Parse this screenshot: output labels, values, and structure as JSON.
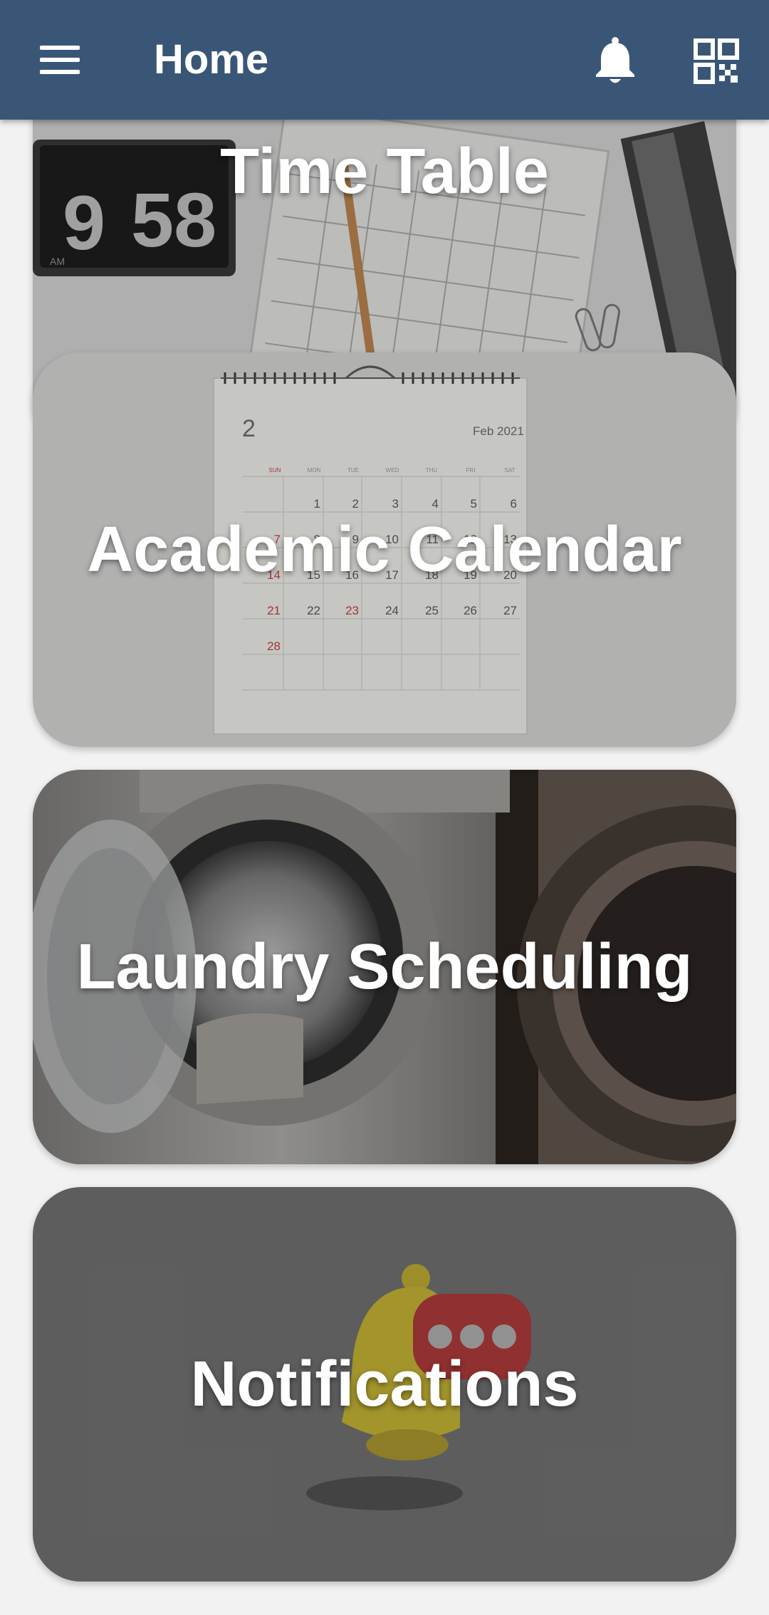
{
  "appbar": {
    "title": "Home",
    "menu_icon": "hamburger-menu-icon",
    "notification_icon": "bell-icon",
    "qr_icon": "qr-code-icon",
    "background_color": "#3a5677"
  },
  "cards": [
    {
      "id": "timetable",
      "title": "Time Table"
    },
    {
      "id": "academic_calendar",
      "title": "Academic Calendar"
    },
    {
      "id": "laundry",
      "title": "Laundry Scheduling"
    },
    {
      "id": "notifications",
      "title": "Notifications"
    }
  ],
  "illustrations": {
    "clock_digits_left": "9",
    "clock_digits_right": "58",
    "clock_ampm": "AM",
    "calendar_month_number": "2",
    "calendar_month_label": "Feb 2021",
    "calendar_weekdays": [
      "SUN",
      "MON",
      "TUE",
      "WED",
      "THU",
      "FRI",
      "SAT"
    ],
    "calendar_dates_row1": [
      "",
      "1",
      "2",
      "3",
      "4",
      "5",
      "6"
    ],
    "calendar_dates_row2": [
      "7",
      "8",
      "9",
      "10",
      "11",
      "12",
      "13"
    ],
    "calendar_dates_row3": [
      "14",
      "15",
      "16",
      "17",
      "18",
      "19",
      "20"
    ],
    "calendar_dates_row4": [
      "21",
      "22",
      "23",
      "24",
      "25",
      "26",
      "27"
    ],
    "calendar_dates_row5": [
      "28",
      "",
      "",
      "",
      "",
      "",
      ""
    ]
  }
}
